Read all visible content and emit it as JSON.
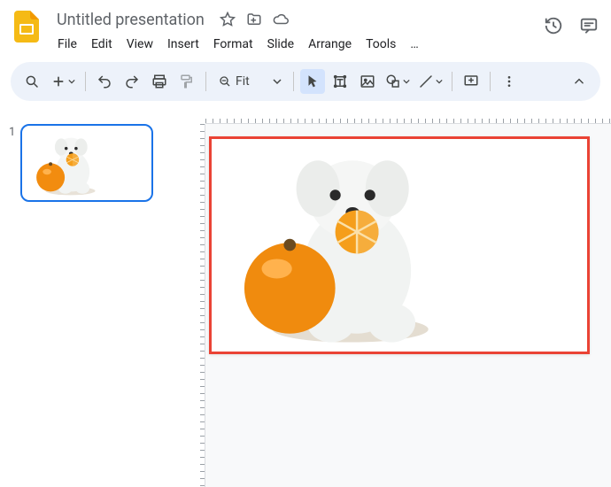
{
  "header": {
    "title": "Untitled presentation"
  },
  "menu": {
    "file": "File",
    "edit": "Edit",
    "view": "View",
    "insert": "Insert",
    "format": "Format",
    "slide": "Slide",
    "arrange": "Arrange",
    "tools": "Tools",
    "more": "…"
  },
  "toolbar": {
    "zoom": "Fit"
  },
  "filmstrip": {
    "slide_number": "1"
  },
  "slide": {
    "selected_image_desc": "white fluffy dog with orange"
  }
}
